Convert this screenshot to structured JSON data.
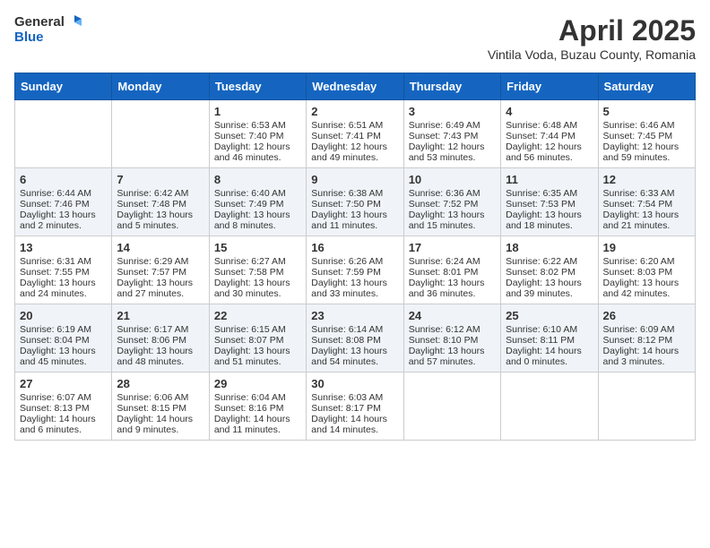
{
  "header": {
    "logo_general": "General",
    "logo_blue": "Blue",
    "month": "April 2025",
    "location": "Vintila Voda, Buzau County, Romania"
  },
  "weekdays": [
    "Sunday",
    "Monday",
    "Tuesday",
    "Wednesday",
    "Thursday",
    "Friday",
    "Saturday"
  ],
  "weeks": [
    [
      {
        "day": "",
        "sunrise": "",
        "sunset": "",
        "daylight": ""
      },
      {
        "day": "",
        "sunrise": "",
        "sunset": "",
        "daylight": ""
      },
      {
        "day": "1",
        "sunrise": "Sunrise: 6:53 AM",
        "sunset": "Sunset: 7:40 PM",
        "daylight": "Daylight: 12 hours and 46 minutes."
      },
      {
        "day": "2",
        "sunrise": "Sunrise: 6:51 AM",
        "sunset": "Sunset: 7:41 PM",
        "daylight": "Daylight: 12 hours and 49 minutes."
      },
      {
        "day": "3",
        "sunrise": "Sunrise: 6:49 AM",
        "sunset": "Sunset: 7:43 PM",
        "daylight": "Daylight: 12 hours and 53 minutes."
      },
      {
        "day": "4",
        "sunrise": "Sunrise: 6:48 AM",
        "sunset": "Sunset: 7:44 PM",
        "daylight": "Daylight: 12 hours and 56 minutes."
      },
      {
        "day": "5",
        "sunrise": "Sunrise: 6:46 AM",
        "sunset": "Sunset: 7:45 PM",
        "daylight": "Daylight: 12 hours and 59 minutes."
      }
    ],
    [
      {
        "day": "6",
        "sunrise": "Sunrise: 6:44 AM",
        "sunset": "Sunset: 7:46 PM",
        "daylight": "Daylight: 13 hours and 2 minutes."
      },
      {
        "day": "7",
        "sunrise": "Sunrise: 6:42 AM",
        "sunset": "Sunset: 7:48 PM",
        "daylight": "Daylight: 13 hours and 5 minutes."
      },
      {
        "day": "8",
        "sunrise": "Sunrise: 6:40 AM",
        "sunset": "Sunset: 7:49 PM",
        "daylight": "Daylight: 13 hours and 8 minutes."
      },
      {
        "day": "9",
        "sunrise": "Sunrise: 6:38 AM",
        "sunset": "Sunset: 7:50 PM",
        "daylight": "Daylight: 13 hours and 11 minutes."
      },
      {
        "day": "10",
        "sunrise": "Sunrise: 6:36 AM",
        "sunset": "Sunset: 7:52 PM",
        "daylight": "Daylight: 13 hours and 15 minutes."
      },
      {
        "day": "11",
        "sunrise": "Sunrise: 6:35 AM",
        "sunset": "Sunset: 7:53 PM",
        "daylight": "Daylight: 13 hours and 18 minutes."
      },
      {
        "day": "12",
        "sunrise": "Sunrise: 6:33 AM",
        "sunset": "Sunset: 7:54 PM",
        "daylight": "Daylight: 13 hours and 21 minutes."
      }
    ],
    [
      {
        "day": "13",
        "sunrise": "Sunrise: 6:31 AM",
        "sunset": "Sunset: 7:55 PM",
        "daylight": "Daylight: 13 hours and 24 minutes."
      },
      {
        "day": "14",
        "sunrise": "Sunrise: 6:29 AM",
        "sunset": "Sunset: 7:57 PM",
        "daylight": "Daylight: 13 hours and 27 minutes."
      },
      {
        "day": "15",
        "sunrise": "Sunrise: 6:27 AM",
        "sunset": "Sunset: 7:58 PM",
        "daylight": "Daylight: 13 hours and 30 minutes."
      },
      {
        "day": "16",
        "sunrise": "Sunrise: 6:26 AM",
        "sunset": "Sunset: 7:59 PM",
        "daylight": "Daylight: 13 hours and 33 minutes."
      },
      {
        "day": "17",
        "sunrise": "Sunrise: 6:24 AM",
        "sunset": "Sunset: 8:01 PM",
        "daylight": "Daylight: 13 hours and 36 minutes."
      },
      {
        "day": "18",
        "sunrise": "Sunrise: 6:22 AM",
        "sunset": "Sunset: 8:02 PM",
        "daylight": "Daylight: 13 hours and 39 minutes."
      },
      {
        "day": "19",
        "sunrise": "Sunrise: 6:20 AM",
        "sunset": "Sunset: 8:03 PM",
        "daylight": "Daylight: 13 hours and 42 minutes."
      }
    ],
    [
      {
        "day": "20",
        "sunrise": "Sunrise: 6:19 AM",
        "sunset": "Sunset: 8:04 PM",
        "daylight": "Daylight: 13 hours and 45 minutes."
      },
      {
        "day": "21",
        "sunrise": "Sunrise: 6:17 AM",
        "sunset": "Sunset: 8:06 PM",
        "daylight": "Daylight: 13 hours and 48 minutes."
      },
      {
        "day": "22",
        "sunrise": "Sunrise: 6:15 AM",
        "sunset": "Sunset: 8:07 PM",
        "daylight": "Daylight: 13 hours and 51 minutes."
      },
      {
        "day": "23",
        "sunrise": "Sunrise: 6:14 AM",
        "sunset": "Sunset: 8:08 PM",
        "daylight": "Daylight: 13 hours and 54 minutes."
      },
      {
        "day": "24",
        "sunrise": "Sunrise: 6:12 AM",
        "sunset": "Sunset: 8:10 PM",
        "daylight": "Daylight: 13 hours and 57 minutes."
      },
      {
        "day": "25",
        "sunrise": "Sunrise: 6:10 AM",
        "sunset": "Sunset: 8:11 PM",
        "daylight": "Daylight: 14 hours and 0 minutes."
      },
      {
        "day": "26",
        "sunrise": "Sunrise: 6:09 AM",
        "sunset": "Sunset: 8:12 PM",
        "daylight": "Daylight: 14 hours and 3 minutes."
      }
    ],
    [
      {
        "day": "27",
        "sunrise": "Sunrise: 6:07 AM",
        "sunset": "Sunset: 8:13 PM",
        "daylight": "Daylight: 14 hours and 6 minutes."
      },
      {
        "day": "28",
        "sunrise": "Sunrise: 6:06 AM",
        "sunset": "Sunset: 8:15 PM",
        "daylight": "Daylight: 14 hours and 9 minutes."
      },
      {
        "day": "29",
        "sunrise": "Sunrise: 6:04 AM",
        "sunset": "Sunset: 8:16 PM",
        "daylight": "Daylight: 14 hours and 11 minutes."
      },
      {
        "day": "30",
        "sunrise": "Sunrise: 6:03 AM",
        "sunset": "Sunset: 8:17 PM",
        "daylight": "Daylight: 14 hours and 14 minutes."
      },
      {
        "day": "",
        "sunrise": "",
        "sunset": "",
        "daylight": ""
      },
      {
        "day": "",
        "sunrise": "",
        "sunset": "",
        "daylight": ""
      },
      {
        "day": "",
        "sunrise": "",
        "sunset": "",
        "daylight": ""
      }
    ]
  ]
}
